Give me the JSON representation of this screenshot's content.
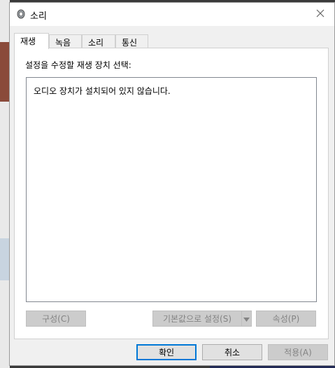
{
  "window": {
    "title": "소리"
  },
  "tabs": [
    {
      "label": "재생",
      "active": true
    },
    {
      "label": "녹음",
      "active": false
    },
    {
      "label": "소리",
      "active": false
    },
    {
      "label": "통신",
      "active": false
    }
  ],
  "playback": {
    "instruction": "설정을 수정할 재생 장치 선택:",
    "empty_message": "오디오 장치가 설치되어 있지 않습니다.",
    "configure_button": "구성(C)",
    "set_default_button": "기본값으로 설정(S)",
    "properties_button": "속성(P)"
  },
  "footer": {
    "ok_button": "확인",
    "cancel_button": "취소",
    "apply_button": "적용(A)"
  },
  "icons": {
    "title": "speaker-icon",
    "close": "close-icon",
    "dropdown": "chevron-down-icon"
  }
}
